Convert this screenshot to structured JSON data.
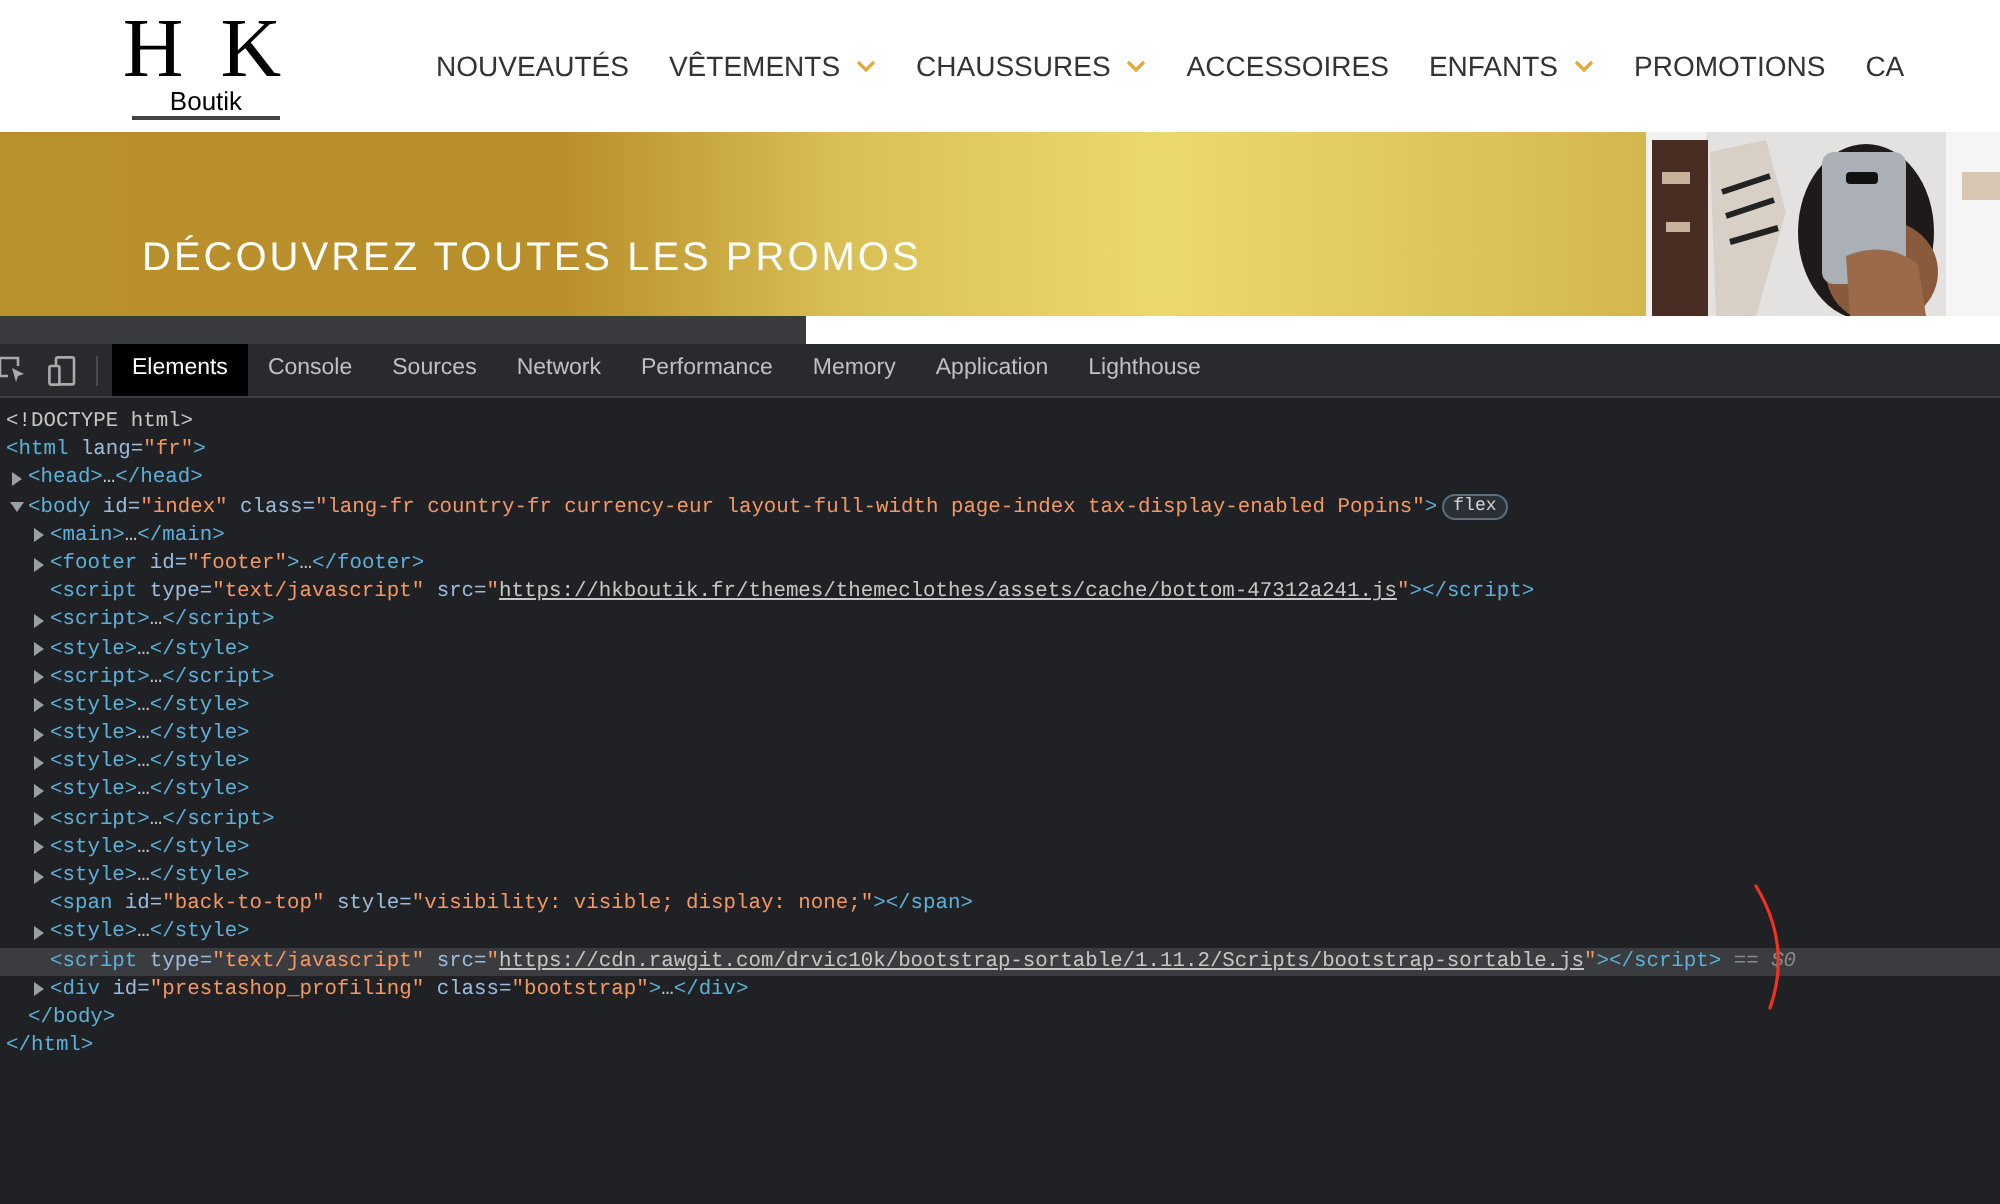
{
  "header": {
    "logo": {
      "letters": "H K",
      "tagline": "Boutik"
    },
    "nav": [
      {
        "label": "NOUVEAUTÉS",
        "has_menu": false
      },
      {
        "label": "VÊTEMENTS",
        "has_menu": true
      },
      {
        "label": "CHAUSSURES",
        "has_menu": true
      },
      {
        "label": "ACCESSOIRES",
        "has_menu": false
      },
      {
        "label": "ENFANTS",
        "has_menu": true
      },
      {
        "label": "PROMOTIONS",
        "has_menu": false
      },
      {
        "label": "CA",
        "has_menu": false
      }
    ]
  },
  "banner": {
    "title": "DÉCOUVREZ TOUTES LES PROMOS"
  },
  "devtools": {
    "tabs": [
      {
        "label": "Elements",
        "selected": true
      },
      {
        "label": "Console",
        "selected": false
      },
      {
        "label": "Sources",
        "selected": false
      },
      {
        "label": "Network",
        "selected": false
      },
      {
        "label": "Performance",
        "selected": false
      },
      {
        "label": "Memory",
        "selected": false
      },
      {
        "label": "Application",
        "selected": false
      },
      {
        "label": "Lighthouse",
        "selected": false
      }
    ],
    "dom_tree": [
      {
        "kind": "plain",
        "selected": false,
        "segments": [
          {
            "kind": "doctype",
            "text": "<!DOCTYPE html>"
          }
        ]
      },
      {
        "kind": "open",
        "selected": false,
        "segments": [
          {
            "kind": "tag",
            "text": "<html"
          },
          {
            "kind": "attr",
            "text": " lang="
          },
          {
            "kind": "value",
            "text": "\"fr\""
          },
          {
            "kind": "tag",
            "text": ">"
          }
        ],
        "closing": [
          {
            "kind": "tag",
            "text": "</html>"
          }
        ],
        "children": [
          {
            "kind": "collapsible",
            "expanded": false,
            "selected": false,
            "segments": [
              {
                "kind": "tag",
                "text": "<head>"
              },
              {
                "kind": "ellipsis",
                "text": "…"
              },
              {
                "kind": "tag",
                "text": "</head>"
              }
            ]
          },
          {
            "kind": "collapsible",
            "expanded": true,
            "selected": false,
            "badge": "flex",
            "segments": [
              {
                "kind": "tag",
                "text": "<body"
              },
              {
                "kind": "attr",
                "text": " id="
              },
              {
                "kind": "value",
                "text": "\"index\""
              },
              {
                "kind": "attr",
                "text": " class="
              },
              {
                "kind": "value",
                "text": "\"lang-fr country-fr currency-eur layout-full-width page-index tax-display-enabled Popins\""
              },
              {
                "kind": "tag",
                "text": ">"
              }
            ],
            "closing": [
              {
                "kind": "tag",
                "text": "</body>"
              }
            ],
            "children": [
              {
                "kind": "collapsible",
                "expanded": false,
                "selected": false,
                "segments": [
                  {
                    "kind": "tag",
                    "text": "<main>"
                  },
                  {
                    "kind": "ellipsis",
                    "text": "…"
                  },
                  {
                    "kind": "tag",
                    "text": "</main>"
                  }
                ]
              },
              {
                "kind": "collapsible",
                "expanded": false,
                "selected": false,
                "segments": [
                  {
                    "kind": "tag",
                    "text": "<footer"
                  },
                  {
                    "kind": "attr",
                    "text": " id="
                  },
                  {
                    "kind": "value",
                    "text": "\"footer\""
                  },
                  {
                    "kind": "tag",
                    "text": ">"
                  },
                  {
                    "kind": "ellipsis",
                    "text": "…"
                  },
                  {
                    "kind": "tag",
                    "text": "</footer>"
                  }
                ]
              },
              {
                "kind": "plain",
                "selected": false,
                "segments": [
                  {
                    "kind": "tag",
                    "text": "<script"
                  },
                  {
                    "kind": "attr",
                    "text": " type="
                  },
                  {
                    "kind": "value",
                    "text": "\"text/javascript\""
                  },
                  {
                    "kind": "attr",
                    "text": " src="
                  },
                  {
                    "kind": "value",
                    "text": "\""
                  },
                  {
                    "kind": "link",
                    "text": "https://hkboutik.fr/themes/themeclothes/assets/cache/bottom-47312a241.js"
                  },
                  {
                    "kind": "value",
                    "text": "\""
                  },
                  {
                    "kind": "tag",
                    "text": "></script>"
                  }
                ]
              },
              {
                "kind": "collapsible",
                "expanded": false,
                "selected": false,
                "segments": [
                  {
                    "kind": "tag",
                    "text": "<script>"
                  },
                  {
                    "kind": "ellipsis",
                    "text": "…"
                  },
                  {
                    "kind": "tag",
                    "text": "</script>"
                  }
                ]
              },
              {
                "kind": "collapsible",
                "expanded": false,
                "selected": false,
                "segments": [
                  {
                    "kind": "tag",
                    "text": "<style>"
                  },
                  {
                    "kind": "ellipsis",
                    "text": "…"
                  },
                  {
                    "kind": "tag",
                    "text": "</style>"
                  }
                ]
              },
              {
                "kind": "collapsible",
                "expanded": false,
                "selected": false,
                "segments": [
                  {
                    "kind": "tag",
                    "text": "<script>"
                  },
                  {
                    "kind": "ellipsis",
                    "text": "…"
                  },
                  {
                    "kind": "tag",
                    "text": "</script>"
                  }
                ]
              },
              {
                "kind": "collapsible",
                "expanded": false,
                "selected": false,
                "segments": [
                  {
                    "kind": "tag",
                    "text": "<style>"
                  },
                  {
                    "kind": "ellipsis",
                    "text": "…"
                  },
                  {
                    "kind": "tag",
                    "text": "</style>"
                  }
                ]
              },
              {
                "kind": "collapsible",
                "expanded": false,
                "selected": false,
                "segments": [
                  {
                    "kind": "tag",
                    "text": "<style>"
                  },
                  {
                    "kind": "ellipsis",
                    "text": "…"
                  },
                  {
                    "kind": "tag",
                    "text": "</style>"
                  }
                ]
              },
              {
                "kind": "collapsible",
                "expanded": false,
                "selected": false,
                "segments": [
                  {
                    "kind": "tag",
                    "text": "<style>"
                  },
                  {
                    "kind": "ellipsis",
                    "text": "…"
                  },
                  {
                    "kind": "tag",
                    "text": "</style>"
                  }
                ]
              },
              {
                "kind": "collapsible",
                "expanded": false,
                "selected": false,
                "segments": [
                  {
                    "kind": "tag",
                    "text": "<style>"
                  },
                  {
                    "kind": "ellipsis",
                    "text": "…"
                  },
                  {
                    "kind": "tag",
                    "text": "</style>"
                  }
                ]
              },
              {
                "kind": "collapsible",
                "expanded": false,
                "selected": false,
                "segments": [
                  {
                    "kind": "tag",
                    "text": "<script>"
                  },
                  {
                    "kind": "ellipsis",
                    "text": "…"
                  },
                  {
                    "kind": "tag",
                    "text": "</script>"
                  }
                ]
              },
              {
                "kind": "collapsible",
                "expanded": false,
                "selected": false,
                "segments": [
                  {
                    "kind": "tag",
                    "text": "<style>"
                  },
                  {
                    "kind": "ellipsis",
                    "text": "…"
                  },
                  {
                    "kind": "tag",
                    "text": "</style>"
                  }
                ]
              },
              {
                "kind": "collapsible",
                "expanded": false,
                "selected": false,
                "segments": [
                  {
                    "kind": "tag",
                    "text": "<style>"
                  },
                  {
                    "kind": "ellipsis",
                    "text": "…"
                  },
                  {
                    "kind": "tag",
                    "text": "</style>"
                  }
                ]
              },
              {
                "kind": "plain",
                "selected": false,
                "segments": [
                  {
                    "kind": "tag",
                    "text": "<span"
                  },
                  {
                    "kind": "attr",
                    "text": " id="
                  },
                  {
                    "kind": "value",
                    "text": "\"back-to-top\""
                  },
                  {
                    "kind": "attr",
                    "text": " style="
                  },
                  {
                    "kind": "value",
                    "text": "\"visibility: visible; display: none;\""
                  },
                  {
                    "kind": "tag",
                    "text": "></span>"
                  }
                ]
              },
              {
                "kind": "collapsible",
                "expanded": false,
                "selected": false,
                "segments": [
                  {
                    "kind": "tag",
                    "text": "<style>"
                  },
                  {
                    "kind": "ellipsis",
                    "text": "…"
                  },
                  {
                    "kind": "tag",
                    "text": "</style>"
                  }
                ]
              },
              {
                "kind": "plain",
                "selected": true,
                "segments": [
                  {
                    "kind": "tag",
                    "text": "<script"
                  },
                  {
                    "kind": "attr",
                    "text": " type="
                  },
                  {
                    "kind": "value",
                    "text": "\"text/javascript\""
                  },
                  {
                    "kind": "attr",
                    "text": " src="
                  },
                  {
                    "kind": "value",
                    "text": "\""
                  },
                  {
                    "kind": "link",
                    "text": "https://cdn.rawgit.com/drvic10k/bootstrap-sortable/1.11.2/Scripts/bootstrap-sortable.js"
                  },
                  {
                    "kind": "value",
                    "text": "\""
                  },
                  {
                    "kind": "tag",
                    "text": "></script>"
                  },
                  {
                    "kind": "note",
                    "text": " == $0"
                  }
                ]
              },
              {
                "kind": "collapsible",
                "expanded": false,
                "selected": false,
                "segments": [
                  {
                    "kind": "tag",
                    "text": "<div"
                  },
                  {
                    "kind": "attr",
                    "text": " id="
                  },
                  {
                    "kind": "value",
                    "text": "\"prestashop_profiling\""
                  },
                  {
                    "kind": "attr",
                    "text": " class="
                  },
                  {
                    "kind": "value",
                    "text": "\"bootstrap\""
                  },
                  {
                    "kind": "tag",
                    "text": ">"
                  },
                  {
                    "kind": "ellipsis",
                    "text": "…"
                  },
                  {
                    "kind": "tag",
                    "text": "</div>"
                  }
                ]
              }
            ]
          }
        ]
      }
    ]
  }
}
